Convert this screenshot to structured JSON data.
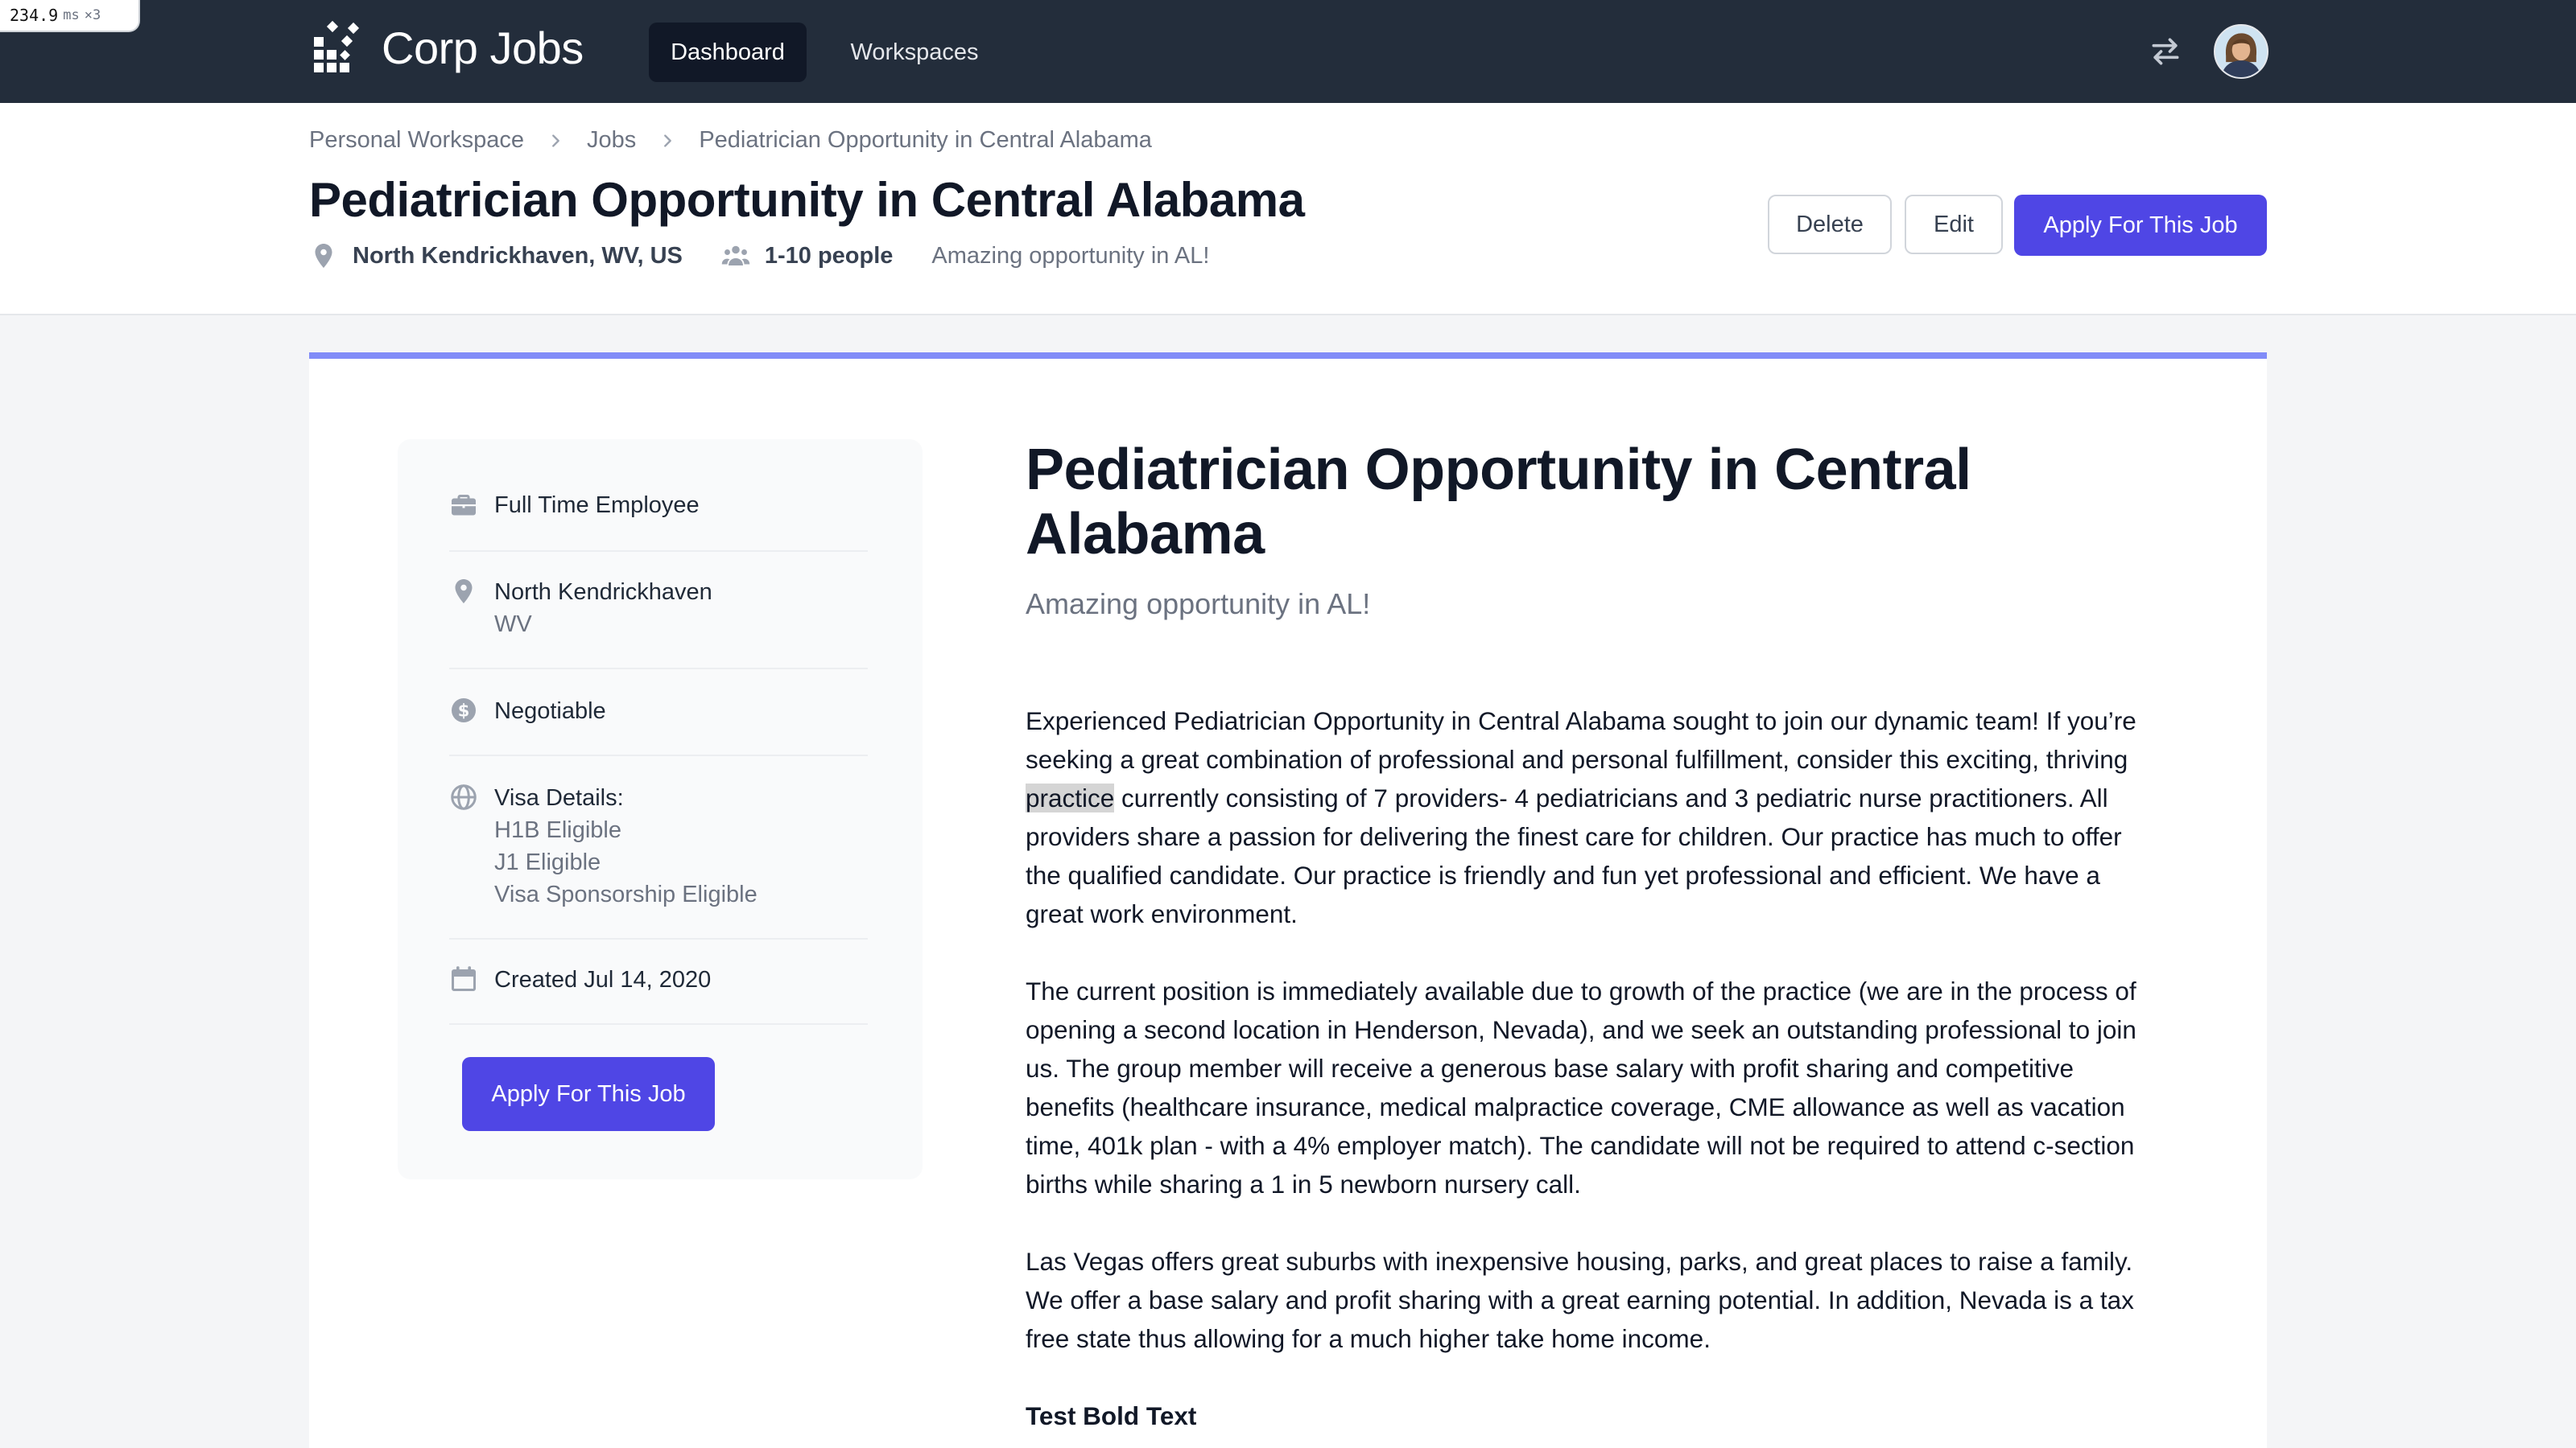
{
  "perf": {
    "value": "234.9",
    "unit": "ms",
    "mult": "×3"
  },
  "nav": {
    "brand": "Corp Jobs",
    "links": [
      "Dashboard",
      "Workspaces"
    ],
    "icons": [
      "switch-icon",
      "avatar"
    ]
  },
  "breadcrumb": [
    "Personal Workspace",
    "Jobs",
    "Pediatrician Opportunity in Central Alabama"
  ],
  "header": {
    "title": "Pediatrician Opportunity in Central Alabama",
    "location": "North Kendrickhaven, WV, US",
    "size": "1-10 people",
    "tagline": "Amazing opportunity in AL!",
    "buttons": {
      "delete": "Delete",
      "edit": "Edit",
      "apply": "Apply For This Job"
    }
  },
  "sidebar": {
    "employment": "Full Time Employee",
    "city": "North Kendrickhaven",
    "state": "WV",
    "salary": "Negotiable",
    "visa_label": "Visa Details:",
    "visa": [
      "H1B Eligible",
      "J1 Eligible",
      "Visa Sponsorship Eligible"
    ],
    "created": "Created Jul 14, 2020",
    "apply": "Apply For This Job"
  },
  "main": {
    "title": "Pediatrician Opportunity in Central Alabama",
    "subtitle": "Amazing opportunity in AL!",
    "p1_before": "Experienced Pediatrician Opportunity in Central Alabama sought to join our dynamic team! If you’re seeking a great combination of professional and personal fulfillment, consider this exciting, thriving ",
    "p1_highlight": "practice",
    "p1_after": " currently consisting of 7 providers- 4 pediatricians and 3 pediatric nurse practitioners. All providers share a passion for delivering the finest care for children. Our practice has much to offer the qualified candidate. Our practice is friendly and fun yet professional and efficient. We have a great work environment.",
    "p2": "The current position is immediately available due to growth of the practice (we are in the process of opening a second location in Henderson, Nevada), and we seek an outstanding professional to join us. The group member will receive a generous base salary with profit sharing and competitive benefits (healthcare insurance, medical malpractice coverage, CME allowance as well as vacation time, 401k plan - with a 4% employer match). The candidate will not be required to attend c-section births while sharing a 1 in 5 newborn nursery call.",
    "p3": "Las Vegas offers great suburbs with inexpensive housing, parks, and great places to raise a family. We offer a base salary and profit sharing with a great earning potential. In addition, Nevada is a tax free state thus allowing for a much higher take home income.",
    "p4": "Test Bold Text"
  },
  "colors": {
    "nav_bg": "#232d3b",
    "primary": "#4f46e5",
    "accent_bar": "#818cf8"
  }
}
